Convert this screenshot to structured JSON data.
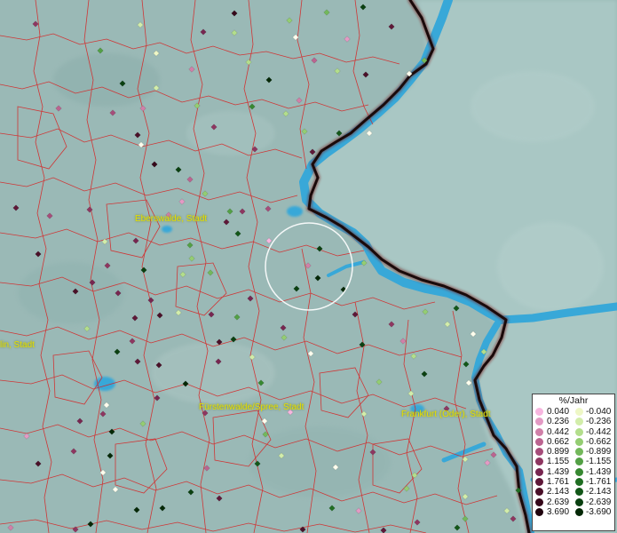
{
  "map": {
    "places": [
      {
        "id": "eberswalde",
        "name": "Eberswalde, Stadt"
      },
      {
        "id": "berlin",
        "name": "lin, Stadt"
      },
      {
        "id": "fuerstenwalde",
        "name": "Fürstenwalde/Spree, Stadt"
      },
      {
        "id": "frankfurt",
        "name": "Frankfurt (Oder), Stadt"
      }
    ],
    "legend": {
      "title": "%/Jahr",
      "positive": [
        "0.040",
        "0.236",
        "0.442",
        "0.662",
        "0.899",
        "1.155",
        "1.439",
        "1.761",
        "2.143",
        "2.639",
        "3.690"
      ],
      "negative": [
        "-0.040",
        "-0.236",
        "-0.442",
        "-0.662",
        "-0.899",
        "-1.155",
        "-1.439",
        "-1.761",
        "-2.143",
        "-2.639",
        "-3.690"
      ],
      "positive_colors": [
        "#f7b6df",
        "#e39ac4",
        "#d080a8",
        "#bb6490",
        "#a64d7a",
        "#8e3660",
        "#772650",
        "#5e1838",
        "#4a1028",
        "#36081a",
        "#20040e"
      ],
      "negative_colors": [
        "#eef7c6",
        "#d2edaa",
        "#b3de8c",
        "#94cd72",
        "#73b85b",
        "#53a045",
        "#378831",
        "#1f6e22",
        "#125718",
        "#0a4010",
        "#042806"
      ]
    },
    "colors": {
      "terrain": "#9ab9b6",
      "river": "#38a8d8",
      "border": "#1a0a0a",
      "boundaries": "#d82020",
      "label": "#e6e000",
      "selection_circle": "#ffffff"
    }
  }
}
